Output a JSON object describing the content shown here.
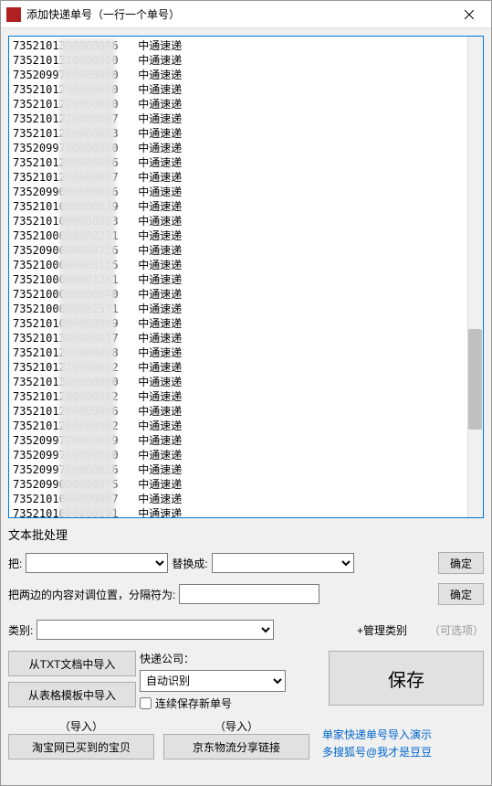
{
  "window": {
    "title": "添加快递单号（一行一个单号）"
  },
  "tracking_list": "7352101300000006   中通速递\n7352101310000000   中通速递\n7352099760000000   中通速递\n7352101290000000   中通速递\n7352101279000000   中通速递\n7352101270000007   中通速递\n7352101260000003   中通速递\n7352099700000000   中通速递\n7352101200000096   中通速递\n7352101200000007   中通速递\n7352099000000096   中通速递\n7352101000000039   中通速递\n7352101000008963   中通速递\n7352100000002231   中通速递\n7352090000004756   中通速递\n7352100000003115   中通速递\n7352100000001281   中通速递\n7352100000000040   中通速递\n7352100000002571   中通速递\n7352101000000099   中通速递\n7352101300000017   中通速递\n7352101200000078   中通速递\n7352101270000002   中通速递\n7352101300000000   中通速递\n7352101280000002   中通速递\n7352101280000006   中通速递\n7352101280000002   中通速递\n7352099770000009   中通速递\n7352099760000000   中通速递\n7352099700000056   中通速递\n7352099000000075   中通速递\n7352101000009087   中通速递\n7352101000000191   中通速递",
  "batch": {
    "section_label": "文本批处理",
    "replace_label": "把:",
    "replace_to_label": "替换成:",
    "confirm_label": "确定",
    "swap_label": "把两边的内容对调位置，分隔符为:",
    "confirm2_label": "确定"
  },
  "category": {
    "label": "类别:",
    "manage_label": "+管理类别",
    "optional_label": "（可选项）"
  },
  "import": {
    "from_txt": "从TXT文档中导入",
    "from_template": "从表格模板中导入",
    "courier_label": "快递公司：",
    "auto_detect": "自动识别",
    "continuous_save": "连续保存新单号",
    "save_label": "保存",
    "import_label_1": "（导入）",
    "taobao_label": "淘宝网已买到的宝贝",
    "import_label_2": "（导入）",
    "jd_label": "京东物流分享链接",
    "link1": "单家快递单号导入演示",
    "link2": "多搜狐号@我才是豆豆"
  }
}
